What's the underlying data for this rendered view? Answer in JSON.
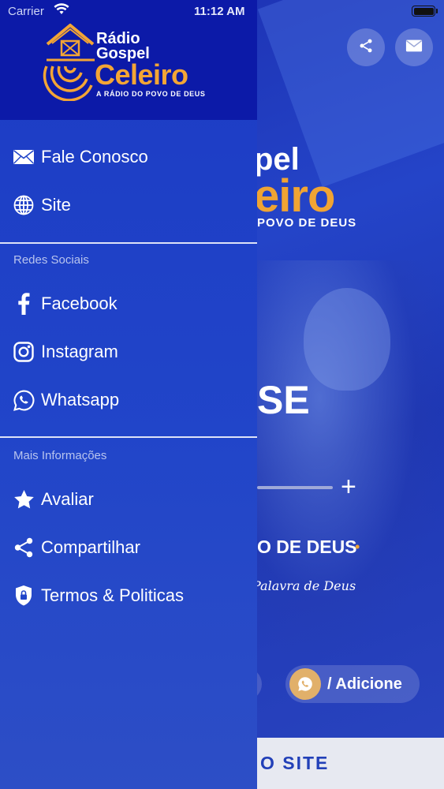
{
  "status_bar": {
    "carrier": "Carrier",
    "time": "11:12 AM"
  },
  "drawer": {
    "logo": {
      "line1": "Rádio",
      "line2": "Gospel",
      "line3": "Celeiro",
      "tagline": "A RÁDIO DO POVO DE DEUS"
    },
    "top_items": [
      {
        "label": "Fale Conosco",
        "icon": "mail-icon"
      },
      {
        "label": "Site",
        "icon": "globe-icon"
      }
    ],
    "social_section": {
      "title": "Redes Sociais",
      "items": [
        {
          "label": "Facebook",
          "icon": "facebook-icon"
        },
        {
          "label": "Instagram",
          "icon": "instagram-icon"
        },
        {
          "label": "Whatsapp",
          "icon": "whatsapp-icon"
        }
      ]
    },
    "info_section": {
      "title": "Mais Informações",
      "items": [
        {
          "label": "Avaliar",
          "icon": "star-icon"
        },
        {
          "label": "Compartilhar",
          "icon": "share-icon"
        },
        {
          "label": "Termos & Politicas",
          "icon": "shield-lock-icon"
        }
      ]
    }
  },
  "background": {
    "logo_partial": "pel",
    "logo_celeiro_partial": "eiro",
    "logo_tag_partial": "POVO DE DEUS",
    "promo_partial": "SE",
    "slogan_partial": "O DE DEUS",
    "script_partial": "Palavra de Deus",
    "whatsapp_pill_text": "/ Adicione",
    "footer_partial": "O SITE"
  },
  "colors": {
    "drawer_header": "#0c1aa8",
    "drawer_body": "#2145c9",
    "accent_orange": "#f3a535"
  }
}
